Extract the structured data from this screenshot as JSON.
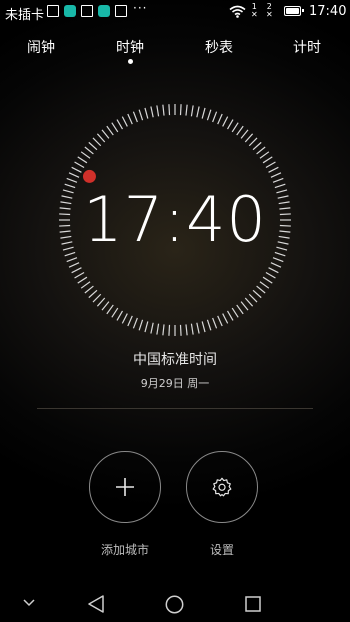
{
  "status_bar": {
    "carrier": "未插卡",
    "overflow": "···",
    "sim1": "1",
    "sim2": "2",
    "battery_level": 0.9,
    "time": "17:40"
  },
  "tabs": [
    {
      "label": "闹钟"
    },
    {
      "label": "时钟"
    },
    {
      "label": "秒表"
    },
    {
      "label": "计时"
    }
  ],
  "active_tab": "时钟",
  "clock": {
    "time": "17:40",
    "timezone": "中国标准时间",
    "date": "9月29日 周一",
    "accent_color": "#d0302a"
  },
  "actions": {
    "add_city_label": "添加城市",
    "settings_label": "设置"
  },
  "icons": [
    "sim-card-icon",
    "app-icon",
    "wifi-icon",
    "battery-icon",
    "plus-icon",
    "gear-icon",
    "back-icon",
    "home-icon",
    "recents-icon"
  ]
}
